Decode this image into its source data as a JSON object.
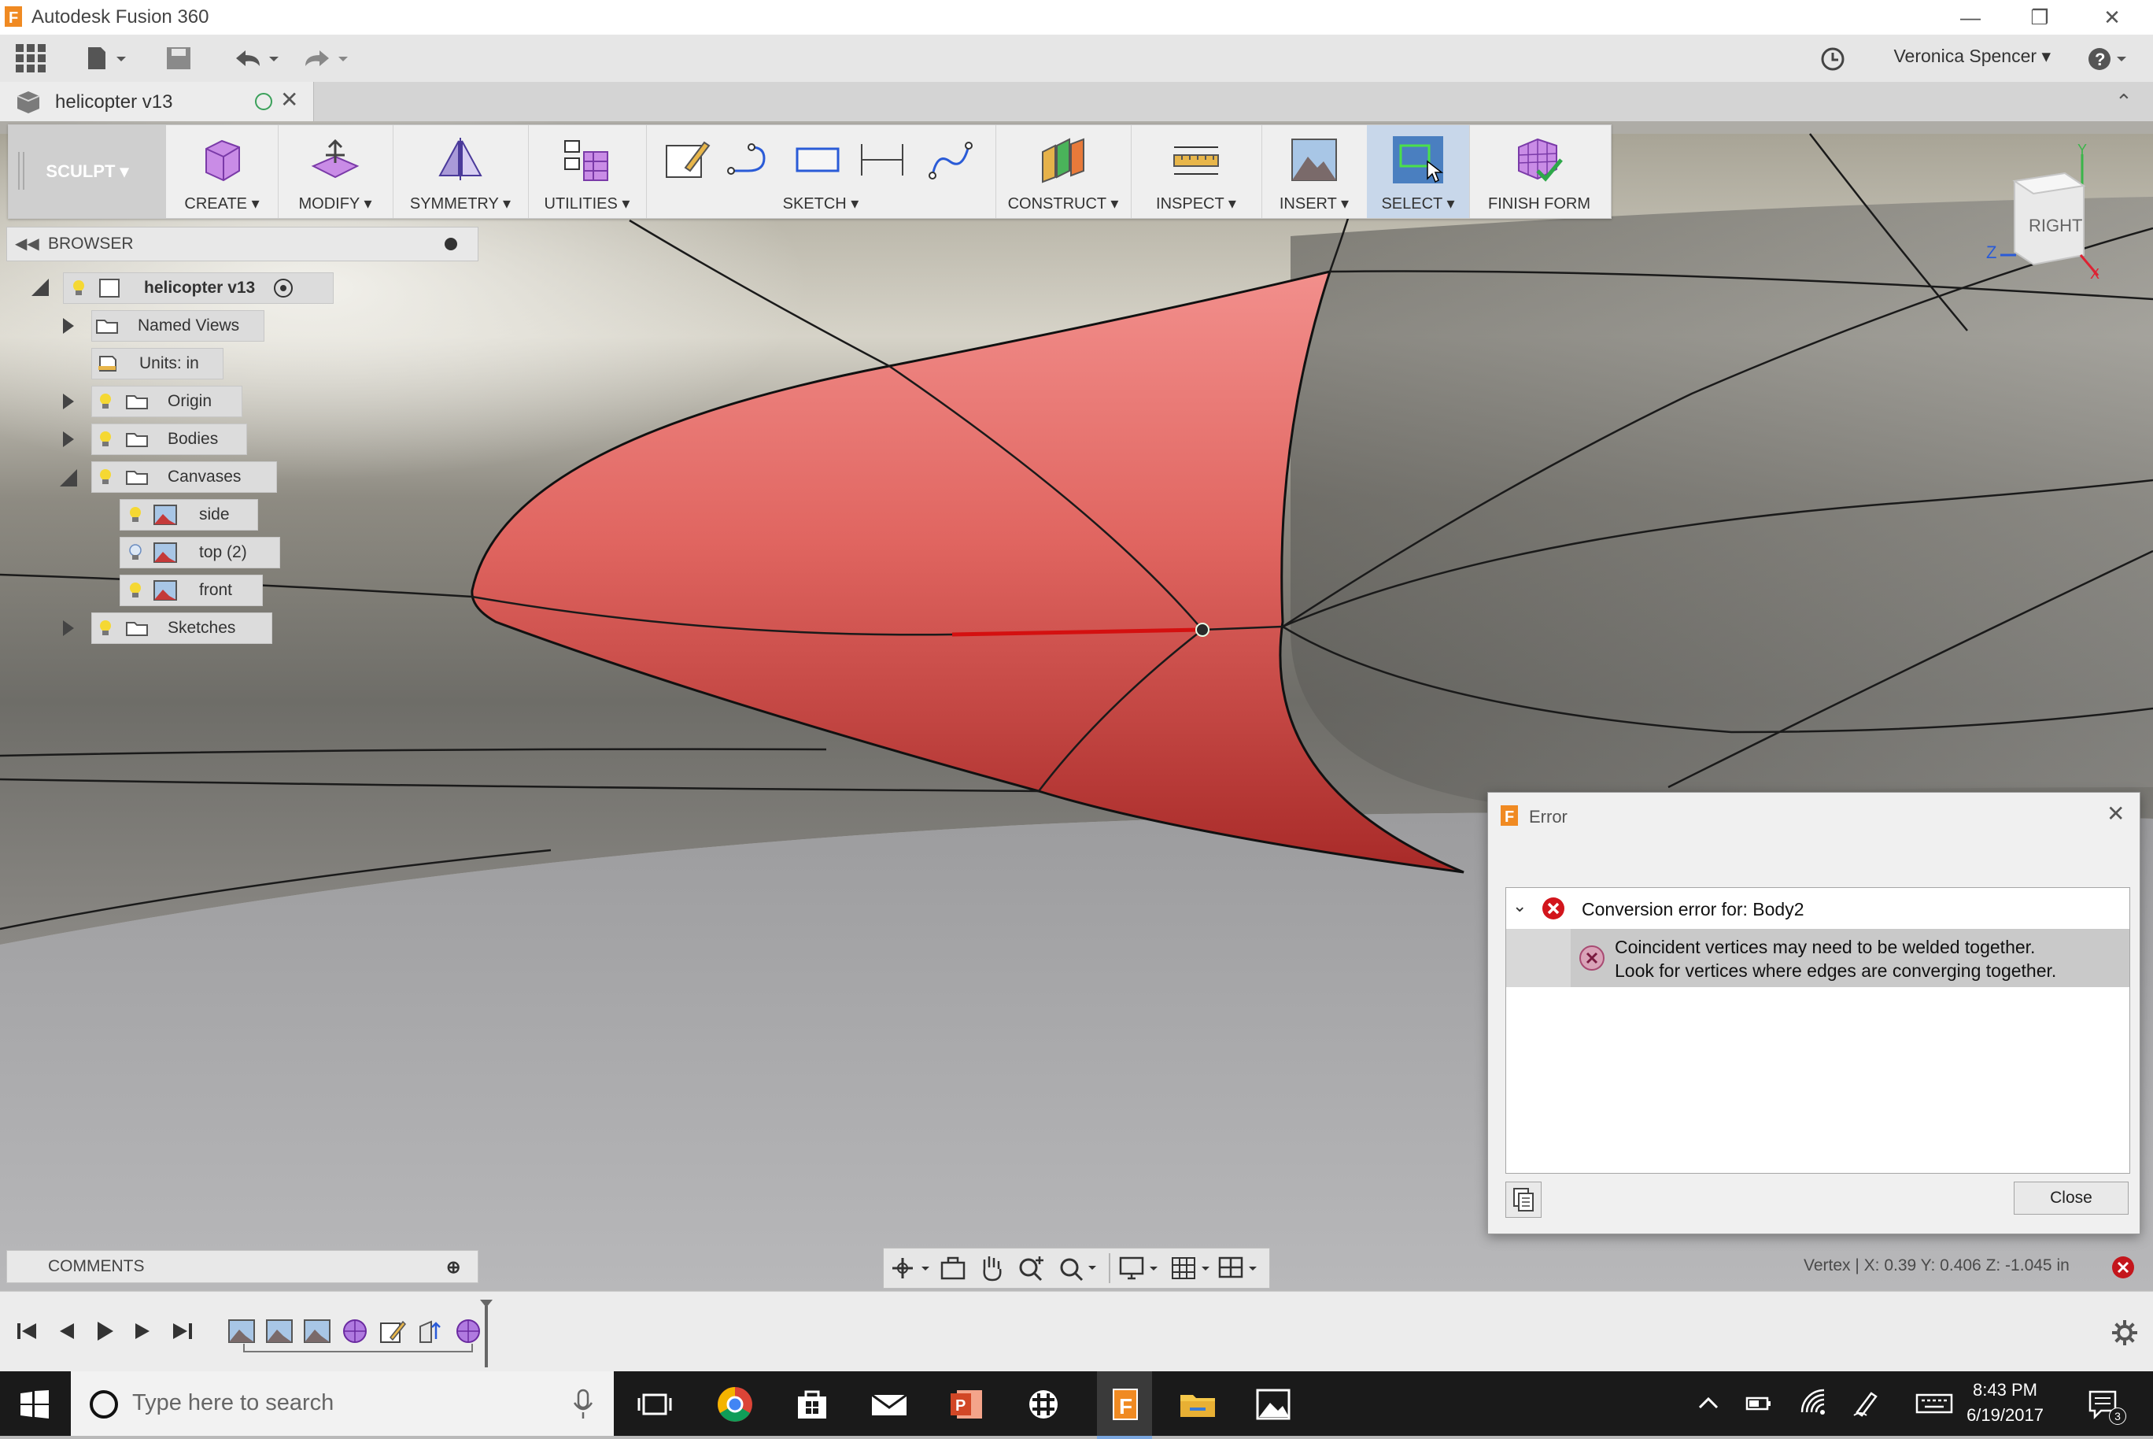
{
  "window": {
    "title": "Autodesk Fusion 360"
  },
  "user": {
    "name": "Veronica Spencer"
  },
  "document": {
    "tab_name": "helicopter v13"
  },
  "toolbar": {
    "workspace": "SCULPT",
    "groups": [
      "CREATE",
      "MODIFY",
      "SYMMETRY",
      "UTILITIES",
      "SKETCH",
      "CONSTRUCT",
      "INSPECT",
      "INSERT",
      "SELECT",
      "FINISH FORM"
    ]
  },
  "browser": {
    "title": "BROWSER",
    "root": "helicopter v13",
    "items": [
      {
        "label": "Named Views"
      },
      {
        "label": "Units: in"
      },
      {
        "label": "Origin"
      },
      {
        "label": "Bodies"
      },
      {
        "label": "Canvases"
      },
      {
        "label": "side"
      },
      {
        "label": "top (2)"
      },
      {
        "label": "front"
      },
      {
        "label": "Sketches"
      }
    ]
  },
  "comments": {
    "title": "COMMENTS"
  },
  "viewcube": {
    "face": "RIGHT",
    "axis_z": "Z",
    "axis_x": "X"
  },
  "status": {
    "vertex": "Vertex | X: 0.39 Y: 0.406 Z: -1.045 in"
  },
  "dialog": {
    "title": "Error",
    "error_header": "Conversion error for: Body2",
    "message_line1": "Coincident vertices may need to be welded together.",
    "message_line2": "Look for vertices where edges are converging together.",
    "close_label": "Close"
  },
  "taskbar": {
    "search_placeholder": "Type here to search",
    "time": "8:43 PM",
    "date": "6/19/2017",
    "notification_count": "3"
  },
  "colors": {
    "surface_highlight": "#e04a4a",
    "accent": "#1f6fc6",
    "error": "#c4161c"
  }
}
